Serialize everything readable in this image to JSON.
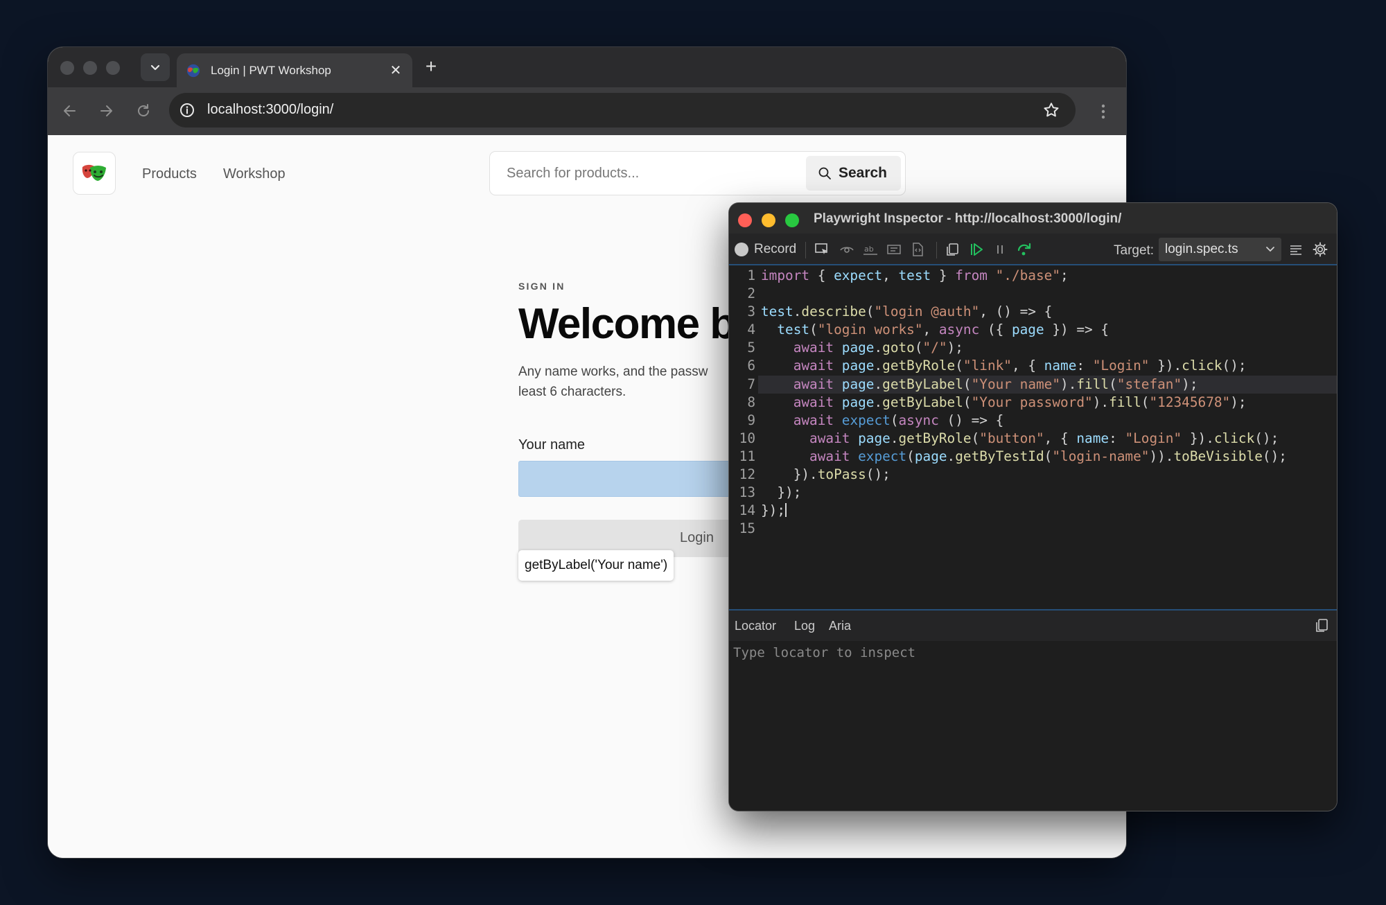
{
  "browser": {
    "tab_title": "Login | PWT Workshop",
    "url": "localhost:3000/login/"
  },
  "site": {
    "nav": [
      "Products",
      "Workshop"
    ],
    "search_placeholder": "Search for products...",
    "search_button": "Search",
    "eyebrow": "SIGN IN",
    "heading": "Welcome b",
    "description": "Any name works, and the passw least 6 characters.",
    "description_line1": "Any name works, and the passw",
    "description_line2": "least 6 characters.",
    "name_label": "Your name",
    "login_button": "Login",
    "locator_tooltip": "getByLabel('Your name')"
  },
  "inspector": {
    "title": "Playwright Inspector - http://localhost:3000/login/",
    "record_label": "Record",
    "target_label": "Target:",
    "target_value": "login.spec.ts",
    "highlighted_line": 7,
    "code_lines": [
      "import { expect, test } from \"./base\";",
      "",
      "test.describe(\"login @auth\", () => {",
      "  test(\"login works\", async ({ page }) => {",
      "    await page.goto(\"/\");",
      "    await page.getByRole(\"link\", { name: \"Login\" }).click();",
      "    await page.getByLabel(\"Your name\").fill(\"stefan\");",
      "    await page.getByLabel(\"Your password\").fill(\"12345678\");",
      "    await expect(async () => {",
      "      await page.getByRole(\"button\", { name: \"Login\" }).click();",
      "      await expect(page.getByTestId(\"login-name\")).toBeVisible();",
      "    }).toPass();",
      "  });",
      "});",
      ""
    ],
    "panel_tabs": [
      "Locator",
      "Log",
      "Aria"
    ],
    "locator_placeholder": "Type locator to inspect"
  },
  "colors": {
    "background": "#0c1525",
    "light_close": "#ff5f57",
    "light_minimize": "#febc2e",
    "light_zoom": "#28c840",
    "resume_green": "#23c15f",
    "highlight_blue": "#b7d3ed"
  },
  "icons": [
    "chevron-down-icon",
    "close-icon",
    "plus-icon",
    "back-arrow-icon",
    "forward-arrow-icon",
    "reload-icon",
    "info-icon",
    "star-icon",
    "more-vertical-icon",
    "search-icon",
    "pick-locator-icon",
    "assert-visibility-icon",
    "assert-text-icon",
    "assert-value-icon",
    "assert-snapshot-icon",
    "copy-icon",
    "resume-icon",
    "pause-icon",
    "step-over-icon",
    "wrap-icon",
    "gear-icon"
  ]
}
